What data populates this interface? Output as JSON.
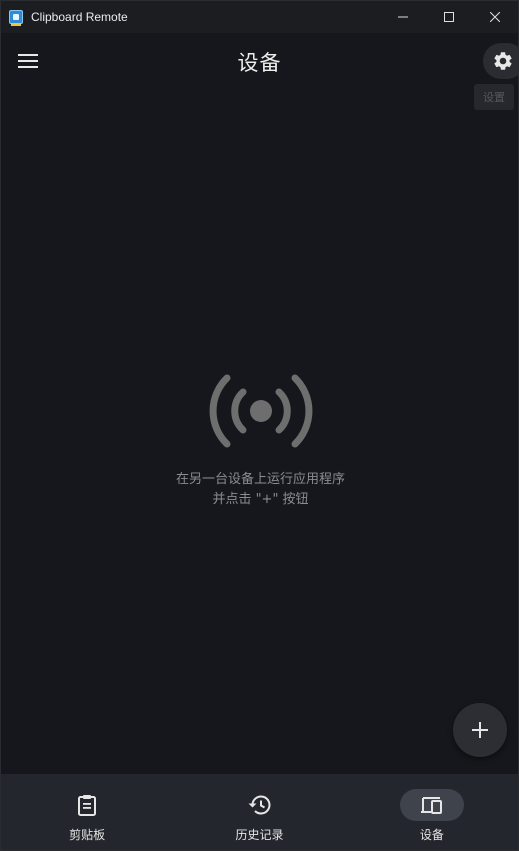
{
  "window": {
    "title": "Clipboard Remote"
  },
  "header": {
    "title": "设备",
    "tooltip": "设置"
  },
  "empty_state": {
    "line1": "在另一台设备上运行应用程序",
    "line2": "并点击 \"+\" 按钮"
  },
  "fab": {
    "label": "+"
  },
  "bottom_nav": {
    "items": [
      {
        "label": "剪贴板",
        "icon": "clipboard-icon",
        "active": false
      },
      {
        "label": "历史记录",
        "icon": "history-icon",
        "active": false
      },
      {
        "label": "设备",
        "icon": "devices-icon",
        "active": true
      }
    ]
  },
  "colors": {
    "background": "#15171c",
    "nav_background": "#23262c",
    "active_indicator": "#3f434b",
    "icon_gray": "#6e6e6e"
  }
}
